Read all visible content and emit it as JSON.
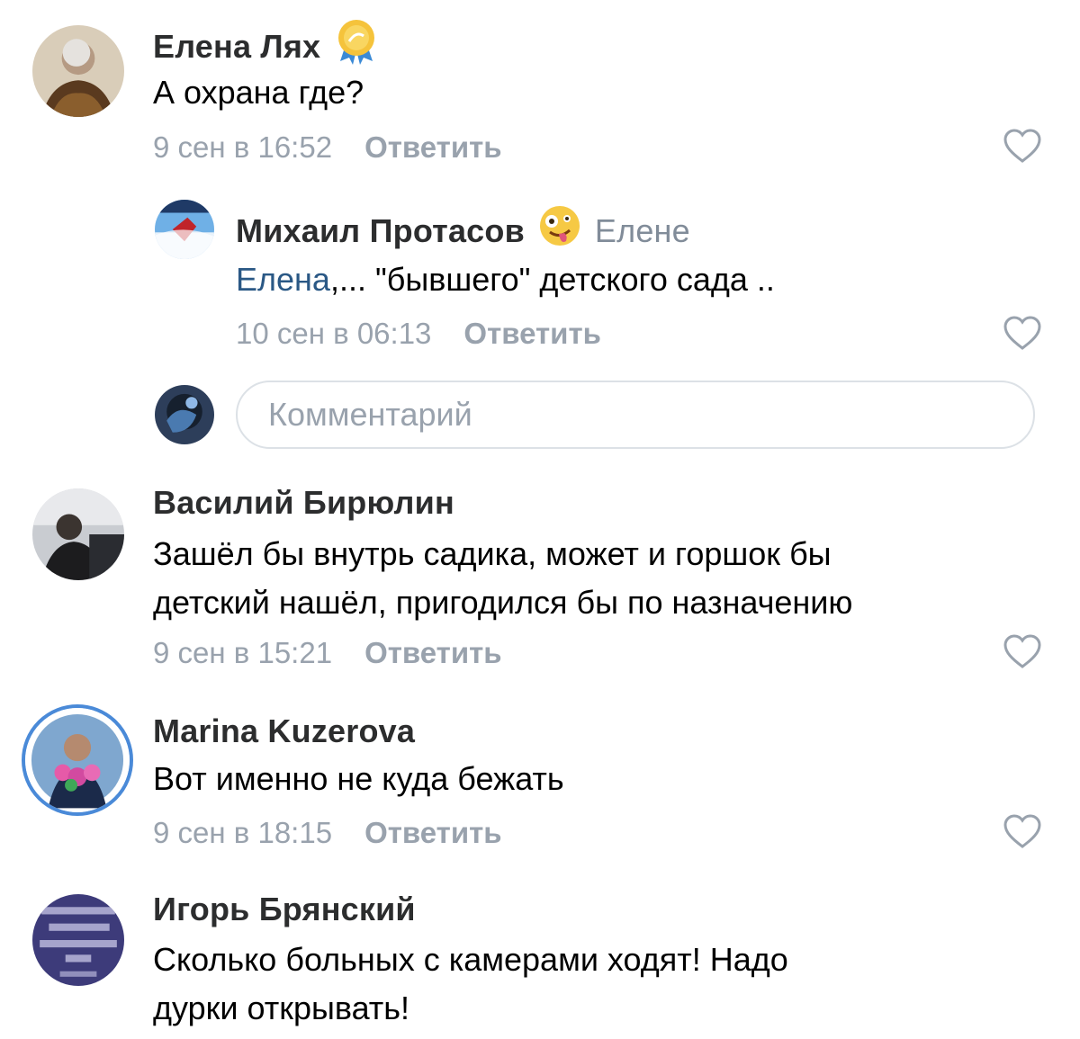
{
  "comments": [
    {
      "author": "Елена Лях",
      "text": "А охрана где?",
      "time": "9 сен в 16:52",
      "reply_label": "Ответить",
      "avatar_icon": "user-photo-avatar",
      "badge_icon": "gold-medal-badge-icon"
    },
    {
      "author": "Михаил Протасов",
      "reply_to": "Елене",
      "mention": "Елена",
      "text": ",... \"бывшего\" детского сада ..",
      "time": "10 сен в 06:13",
      "reply_label": "Ответить",
      "avatar_icon": "user-photo-avatar",
      "badge_icon": "zany-face-emoji-icon"
    },
    {
      "author": "Василий Бирюлин",
      "text_lines": [
        "Зашёл бы внутрь садика, может и горшок бы",
        "детский нашёл, пригодился бы по назначению"
      ],
      "time": "9 сен в 15:21",
      "reply_label": "Ответить",
      "avatar_icon": "user-photo-avatar"
    },
    {
      "author": "Marina Kuzerova",
      "text": "Вот именно не куда бежать",
      "time": "9 сен в 18:15",
      "reply_label": "Ответить",
      "avatar_icon": "user-photo-avatar"
    },
    {
      "author": "Игорь Брянский",
      "text_lines": [
        "Сколько больных с камерами ходят! Надо",
        "дурки открывать!"
      ],
      "avatar_icon": "user-photo-avatar"
    }
  ],
  "comment_input": {
    "placeholder": "Комментарий"
  },
  "colors": {
    "author": "#2c2d2e",
    "text": "#000000",
    "meta": "#99a2ad",
    "mention": "#2a5885",
    "input_border": "#dce1e6"
  },
  "icons": {
    "like": "heart-outline-icon"
  }
}
